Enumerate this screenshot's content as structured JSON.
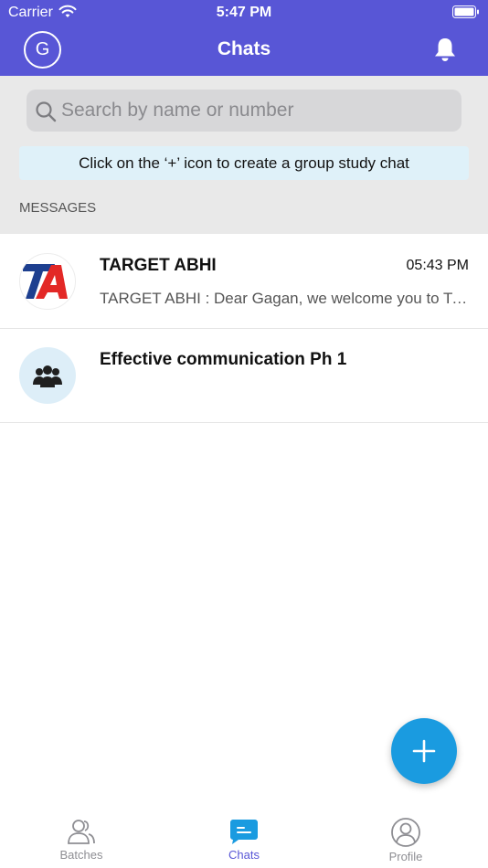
{
  "status_bar": {
    "carrier": "Carrier",
    "time": "5:47 PM"
  },
  "nav": {
    "avatar_initial": "G",
    "title": "Chats",
    "bell_icon": "bell-icon"
  },
  "search": {
    "placeholder": "Search by name or number",
    "value": ""
  },
  "info_banner": "Click on the ‘+’ icon to create a group study chat",
  "section_header": "MESSAGES",
  "chats": [
    {
      "name": "TARGET ABHI",
      "time": "05:43 PM",
      "preview": "TARGET ABHI : Dear Gagan, we welcome you to TARGET ABHI",
      "avatar": "target-abhi-logo"
    },
    {
      "name": "Effective communication Ph 1",
      "time": "",
      "preview": "",
      "avatar": "group-icon"
    }
  ],
  "fab_icon": "plus-icon",
  "tabs": [
    {
      "label": "Batches",
      "icon": "users-icon",
      "active": false
    },
    {
      "label": "Chats",
      "icon": "chat-icon",
      "active": true
    },
    {
      "label": "Profile",
      "icon": "profile-icon",
      "active": false
    }
  ],
  "colors": {
    "header": "#5856d6",
    "accent": "#1a9be0",
    "info_bg": "#dff1f9",
    "logo_blue": "#1d3f8f",
    "logo_red": "#e32826"
  }
}
